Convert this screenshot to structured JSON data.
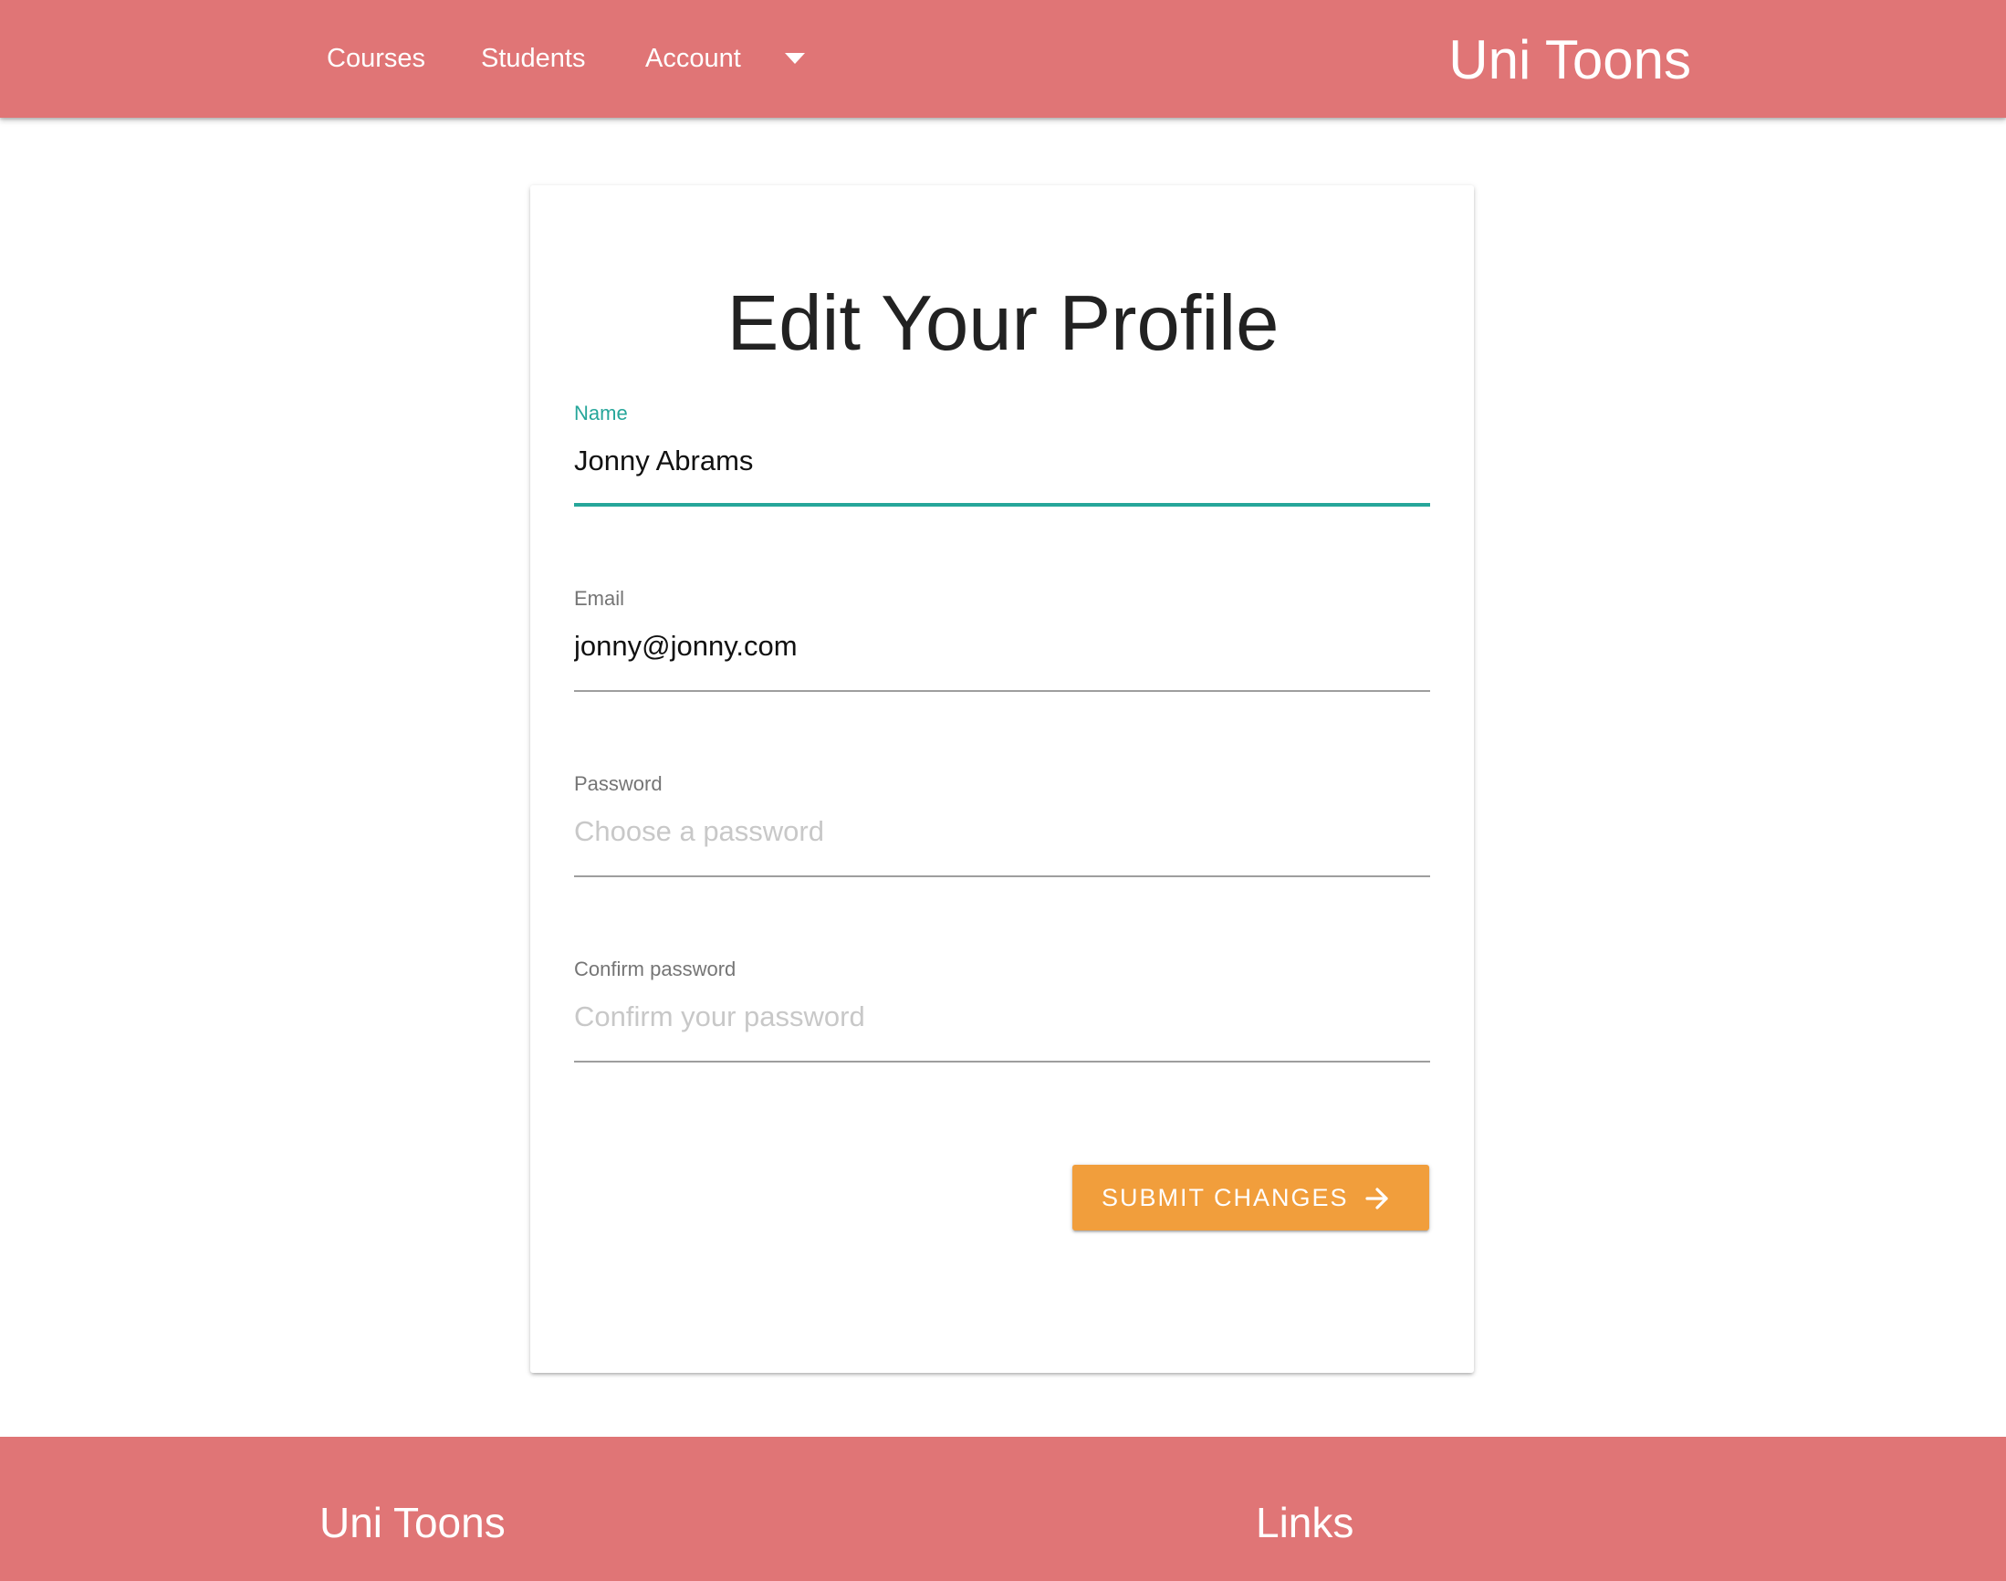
{
  "colors": {
    "navbar_bg": "#e07576",
    "accent_teal": "#26a69a",
    "button_orange": "#f19e3c",
    "footer_bg": "#e07576"
  },
  "navbar": {
    "links": [
      {
        "label": "Courses"
      },
      {
        "label": "Students"
      },
      {
        "label": "Account"
      }
    ],
    "dropdown_icon": "caret-down-icon",
    "brand": "Uni Toons"
  },
  "form": {
    "title": "Edit Your Profile",
    "fields": {
      "name": {
        "label": "Name",
        "value": "Jonny Abrams",
        "placeholder": ""
      },
      "email": {
        "label": "Email",
        "value": "jonny@jonny.com",
        "placeholder": ""
      },
      "password": {
        "label": "Password",
        "value": "",
        "placeholder": "Choose a password"
      },
      "confirm_password": {
        "label": "Confirm password",
        "value": "",
        "placeholder": "Confirm your password"
      }
    },
    "submit": {
      "label": "SUBMIT CHANGES",
      "icon": "arrow-right-icon"
    }
  },
  "footer": {
    "brand": "Uni Toons",
    "links_heading": "Links"
  }
}
